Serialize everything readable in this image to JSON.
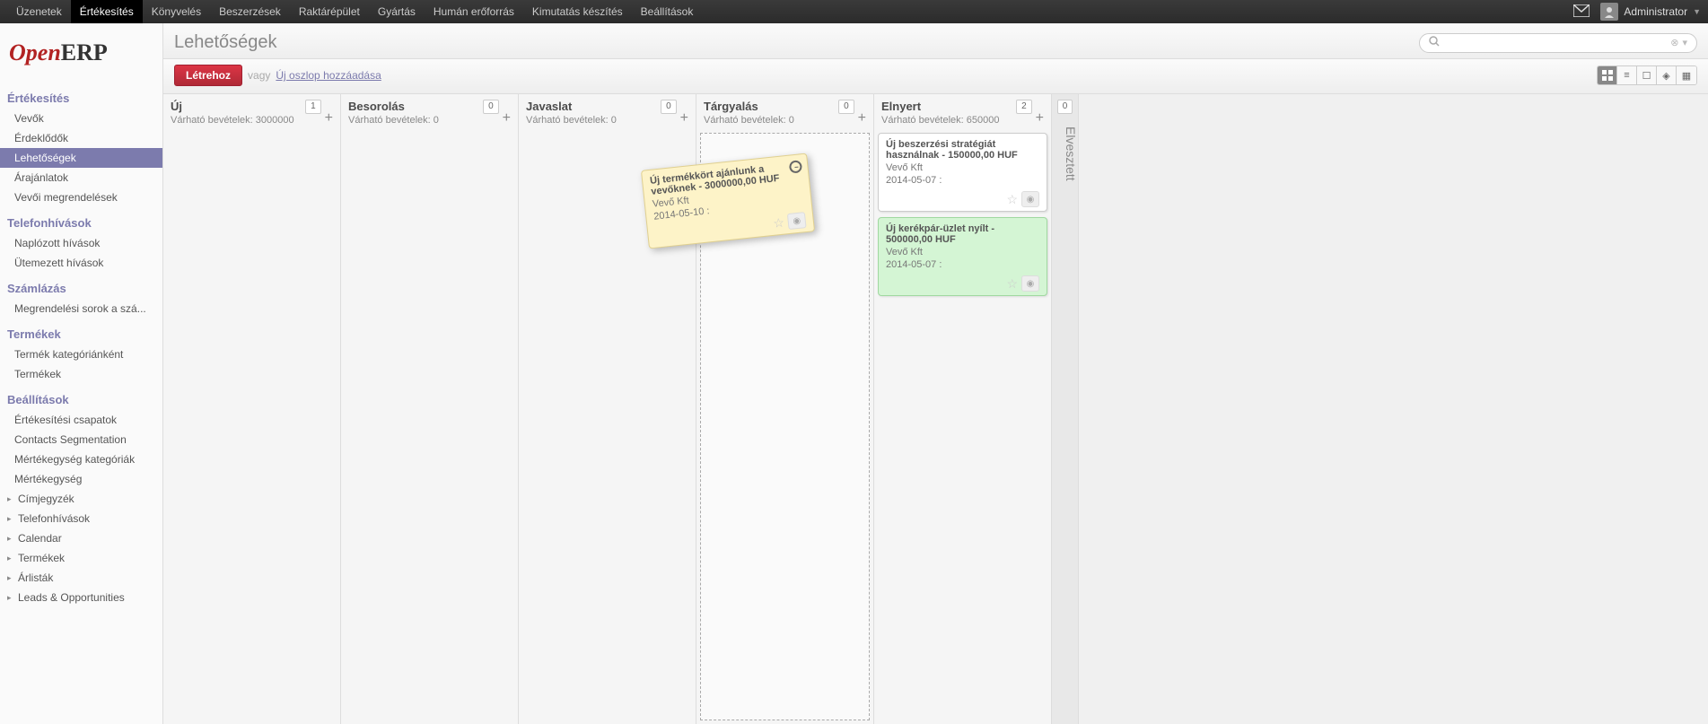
{
  "topnav": {
    "items": [
      "Üzenetek",
      "Értékesítés",
      "Könyvelés",
      "Beszerzések",
      "Raktárépület",
      "Gyártás",
      "Humán erőforrás",
      "Kimutatás készítés",
      "Beállítások"
    ],
    "active_index": 1,
    "user": "Administrator"
  },
  "sidebar": {
    "sections": [
      {
        "title": "Értékesítés",
        "items": [
          "Vevők",
          "Érdeklődők",
          "Lehetőségek",
          "Árajánlatok",
          "Vevői megrendelések"
        ],
        "active": "Lehetőségek"
      },
      {
        "title": "Telefonhívások",
        "items": [
          "Naplózott hívások",
          "Ütemezett hívások"
        ]
      },
      {
        "title": "Számlázás",
        "items": [
          "Megrendelési sorok a szá..."
        ]
      },
      {
        "title": "Termékek",
        "items": [
          "Termék kategóriánként",
          "Termékek"
        ]
      },
      {
        "title": "Beállítások",
        "items": [
          "Értékesítési csapatok",
          "Contacts Segmentation",
          "Mértékegység kategóriák",
          "Mértékegység"
        ],
        "expandable": [
          "Címjegyzék",
          "Telefonhívások",
          "Calendar",
          "Termékek",
          "Árlisták",
          "Leads & Opportunities"
        ]
      }
    ]
  },
  "header": {
    "title": "Lehetőségek",
    "create": "Létrehoz",
    "or": "vagy",
    "add_column": "Új oszlop hozzáadása",
    "search_placeholder": ""
  },
  "kanban": {
    "revenue_label": "Várható bevételek:",
    "columns": [
      {
        "title": "Új",
        "count": "1",
        "revenue": "3000000",
        "drop": false,
        "dragging_card": {
          "title": "Új termékkört ajánlunk a vevőknek",
          "amount": "3000000,00 HUF",
          "company": "Vevő Kft",
          "date": "2014-05-10 :"
        }
      },
      {
        "title": "Besorolás",
        "count": "0",
        "revenue": "0"
      },
      {
        "title": "Javaslat",
        "count": "0",
        "revenue": "0"
      },
      {
        "title": "Tárgyalás",
        "count": "0",
        "revenue": "0",
        "drop": true
      },
      {
        "title": "Elnyert",
        "count": "2",
        "revenue": "650000",
        "cards": [
          {
            "cls": "white",
            "title": "Új beszerzési stratégiát használnak",
            "amount": "150000,00 HUF",
            "company": "Vevő Kft",
            "date": "2014-05-07 :"
          },
          {
            "cls": "green",
            "title": "Új kerékpár-üzlet nyílt",
            "amount": "500000,00 HUF",
            "company": "Vevő Kft",
            "date": "2014-05-07 :"
          }
        ]
      },
      {
        "title": "Elvesztett",
        "count": "0",
        "folded": true
      }
    ]
  }
}
